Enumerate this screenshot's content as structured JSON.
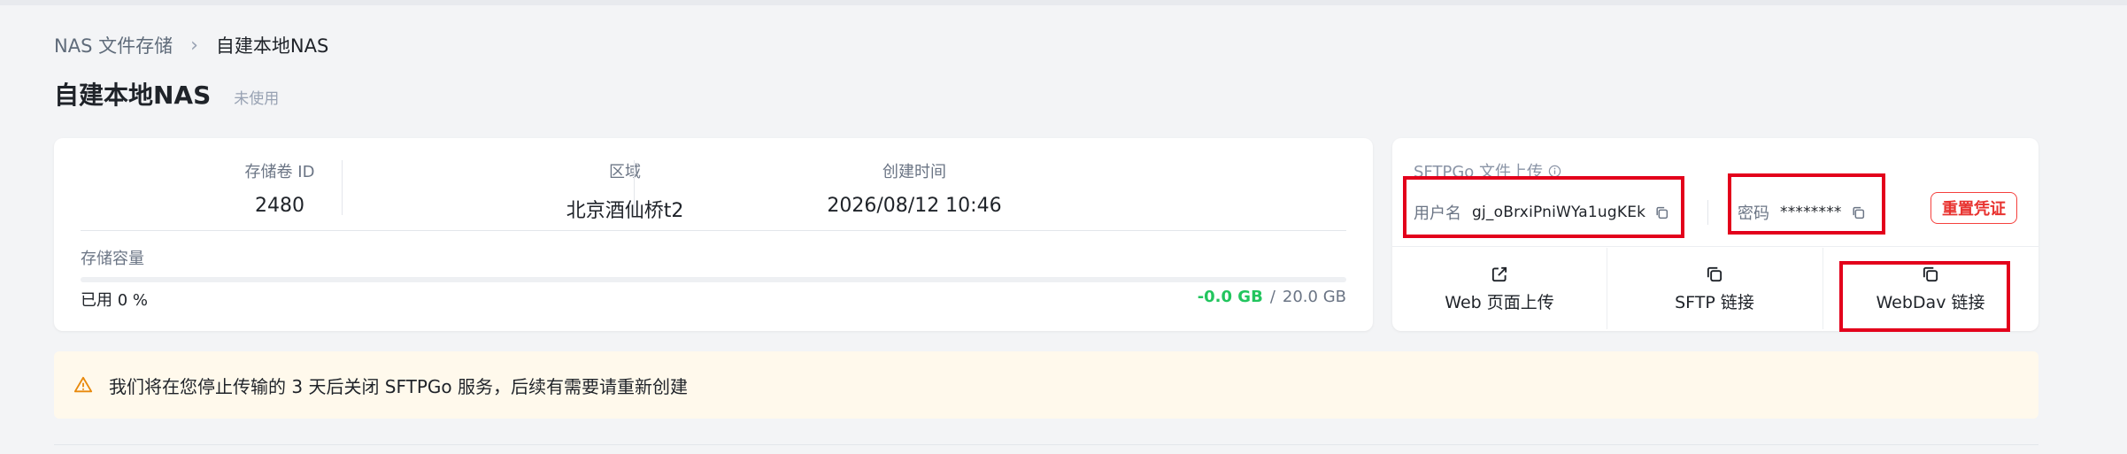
{
  "breadcrumb": {
    "parent": "NAS 文件存储",
    "separator": "›",
    "current": "自建本地NAS"
  },
  "page": {
    "title": "自建本地NAS",
    "status": "未使用"
  },
  "info": {
    "volume_id_label": "存储卷 ID",
    "volume_id": "2480",
    "region_label": "区域",
    "region": "北京酒仙桥t2",
    "created_label": "创建时间",
    "created": "2026/08/12 10:46"
  },
  "capacity": {
    "label": "存储容量",
    "used_text": "已用 0 %",
    "used_percent": 0,
    "used_value": "-0.0 GB",
    "slash": "/",
    "total_value": "20.0 GB"
  },
  "sftp": {
    "title": "SFTPGo 文件上传",
    "username_label": "用户名",
    "username": "gj_oBrxiPniWYa1ugKEk",
    "password_label": "密码",
    "password": "********",
    "reset_label": "重置凭证",
    "links": [
      {
        "label": "Web 页面上传",
        "icon": "external-link-icon"
      },
      {
        "label": "SFTP 链接",
        "icon": "copy-icon"
      },
      {
        "label": "WebDav 链接",
        "icon": "copy-icon"
      }
    ]
  },
  "notice": {
    "icon": "warning-icon",
    "text": "我们将在您停止传输的 3 天后关闭 SFTPGo 服务，后续有需要请重新创建"
  },
  "colors": {
    "accent_green": "#22c55e",
    "danger_red": "#e8322f",
    "highlight_red": "#e3001b",
    "warning_bg": "#fff9ec",
    "warning_icon": "#e8890c"
  }
}
